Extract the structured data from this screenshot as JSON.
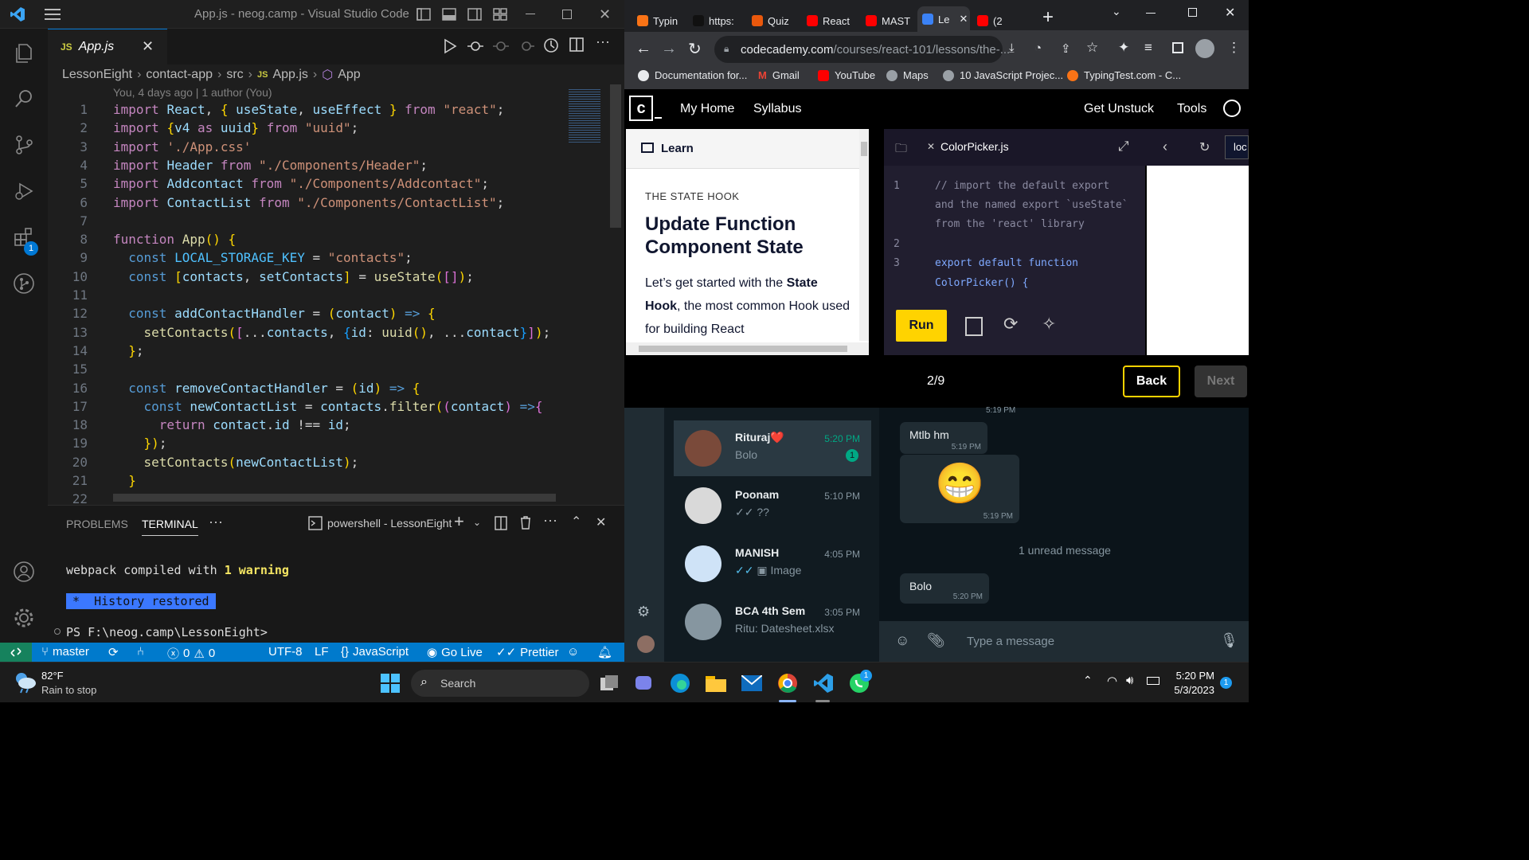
{
  "vscode": {
    "title": "App.js - neog.camp - Visual Studio Code",
    "tab_label": "App.js",
    "tab_lang": "JS",
    "breadcrumb": [
      "LessonEight",
      "contact-app",
      "src",
      "App.js",
      "App"
    ],
    "blame": "You, 4 days ago | 1 author (You)",
    "extensions_badge": "1",
    "code_lines": [
      "import React, { useState, useEffect } from \"react\";",
      "import {v4 as uuid} from \"uuid\";",
      "import './App.css'",
      "import Header from \"./Components/Header\";",
      "import Addcontact from \"./Components/Addcontact\";",
      "import ContactList from \"./Components/ContactList\";",
      "",
      "function App() {",
      "  const LOCAL_STORAGE_KEY = \"contacts\";",
      "  const [contacts, setContacts] = useState([]);",
      "",
      "  const addContactHandler = (contact) => {",
      "    setContacts([...contacts, {id: uuid(), ...contact}]);",
      "  };",
      "",
      "  const removeContactHandler = (id) => {",
      "    const newContactList = contacts.filter((contact) =>{",
      "      return contact.id !== id;",
      "    });",
      "    setContacts(newContactList);",
      "  }",
      ""
    ],
    "panel": {
      "tabs": [
        "PROBLEMS",
        "TERMINAL"
      ],
      "terminal_name": "powershell - LessonEight",
      "line1_prefix": "webpack compiled with ",
      "line1_count": "1 warning",
      "history": "*  History restored",
      "prompt": "PS F:\\neog.camp\\LessonEight>"
    },
    "status": {
      "branch": "master",
      "errors": "0",
      "warnings": "0",
      "encoding": "UTF-8",
      "eol": "LF",
      "language": "JavaScript",
      "golive": "Go Live",
      "prettier": "Prettier"
    }
  },
  "chrome": {
    "tabs": [
      {
        "label": "Typin",
        "color": "#f97316"
      },
      {
        "label": "https:",
        "color": "#111111"
      },
      {
        "label": "Quiz",
        "color": "#ea580c"
      },
      {
        "label": "React",
        "color": "#ff0000"
      },
      {
        "label": "MAST",
        "color": "#ff0000"
      },
      {
        "label": "Le",
        "color": "#3b82f6"
      },
      {
        "label": "(2",
        "color": "#ff0000"
      }
    ],
    "url_domain": "codecademy.com",
    "url_path": "/courses/react-101/lessons/the-...",
    "bookmarks": [
      "Documentation for...",
      "Gmail",
      "YouTube",
      "Maps",
      "10 JavaScript Projec...",
      "TypingTest.com - C..."
    ]
  },
  "codecademy": {
    "nav": [
      "My Home",
      "Syllabus"
    ],
    "nav_right": [
      "Get Unstuck",
      "Tools"
    ],
    "learn_label": "Learn",
    "eyebrow": "THE STATE HOOK",
    "heading": "Update Function Component State",
    "body_pre": "Let’s get started with the ",
    "body_bold1": "State Hook",
    "body_post": ", the most common Hook used for building React",
    "file_tab": "ColorPicker.js",
    "browser_url": "loc",
    "run_label": "Run",
    "progress": "2/9",
    "back_label": "Back",
    "next_label": "Next",
    "editor_lines": [
      {
        "n": "1",
        "text": "// import the default export"
      },
      {
        "n": "",
        "text": "and the named export `useState`"
      },
      {
        "n": "",
        "text": "from the 'react' library"
      },
      {
        "n": "2",
        "text": ""
      },
      {
        "n": "3",
        "text": "export default function"
      },
      {
        "n": "",
        "text": "ColorPicker() {"
      }
    ]
  },
  "whatsapp": {
    "chats": [
      {
        "name": "Rituraj❤️",
        "preview": "Bolo",
        "time": "5:20 PM",
        "unread": "1"
      },
      {
        "name": "Poonam",
        "preview": "??",
        "time": "5:10 PM"
      },
      {
        "name": "MANISH",
        "preview": "Image",
        "time": "4:05 PM"
      },
      {
        "name": "BCA 4th Sem",
        "preview": "Ritu: Datesheet.xlsx",
        "time": "3:05 PM"
      }
    ],
    "messages": [
      {
        "text": "Mtlb hm",
        "time": "5:19 PM"
      },
      {
        "emoji": "😁",
        "time": "5:19 PM"
      },
      {
        "text": "Bolo",
        "time": "5:20 PM"
      }
    ],
    "top_time": "5:19 PM",
    "unread_divider": "1 unread message",
    "input_placeholder": "Type a message"
  },
  "taskbar": {
    "weather_temp": "82°F",
    "weather_desc": "Rain to stop",
    "search": "Search",
    "time": "5:20 PM",
    "date": "5/3/2023",
    "whatsapp_badge": "1",
    "notif_badge": "1"
  }
}
